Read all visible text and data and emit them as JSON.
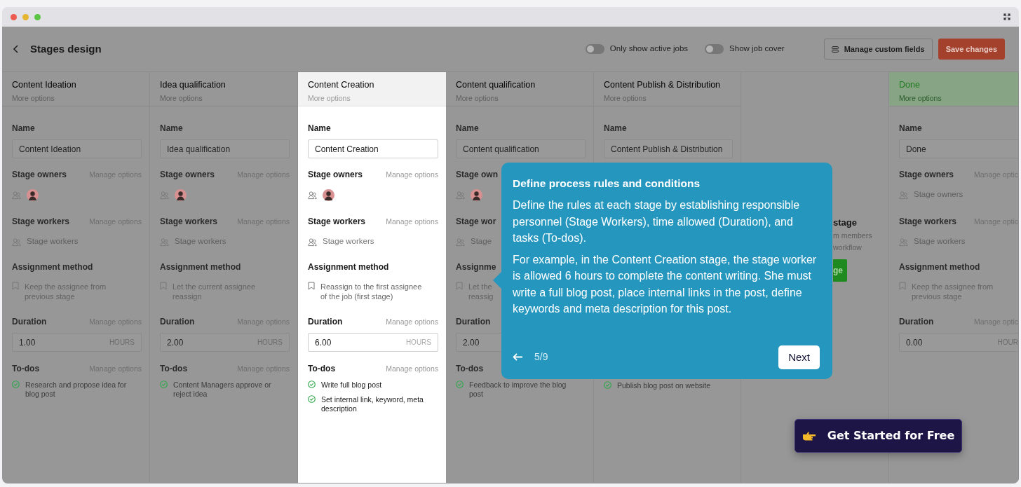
{
  "header": {
    "title": "Stages design",
    "toggles": [
      {
        "label": "Only show active jobs",
        "on": false
      },
      {
        "label": "Show job cover",
        "on": false
      }
    ],
    "buttons": [
      {
        "label": "Manage custom fields",
        "kind": "outline"
      },
      {
        "label": "Save changes",
        "kind": "primary"
      }
    ]
  },
  "stages": [
    {
      "kind": "stage",
      "name": "Content Ideation",
      "more": "More options",
      "selected": false,
      "sections": [
        {
          "kind": "name",
          "label": "Name",
          "value": "Content Ideation"
        },
        {
          "kind": "people",
          "label": "Stage owners",
          "manage": "Manage options",
          "avatar": true
        },
        {
          "kind": "people",
          "label": "Stage workers",
          "manage": "Manage options",
          "empty_text": "Stage workers"
        },
        {
          "kind": "assign",
          "label": "Assignment method",
          "lines": [
            "Keep the assignee from",
            "previous stage"
          ]
        },
        {
          "kind": "duration",
          "label": "Duration",
          "manage": "Manage options",
          "value": "1.00",
          "unit": "HOURS"
        },
        {
          "kind": "todos",
          "label": "To-dos",
          "manage": "Manage options",
          "items": [
            "Research and propose idea for blog post"
          ]
        }
      ]
    },
    {
      "kind": "stage",
      "name": "Idea qualification",
      "more": "More options",
      "selected": false,
      "sections": [
        {
          "kind": "name",
          "label": "Name",
          "value": "Idea qualification"
        },
        {
          "kind": "people",
          "label": "Stage owners",
          "manage": "Manage options",
          "avatar": true
        },
        {
          "kind": "people",
          "label": "Stage workers",
          "manage": "Manage options",
          "empty_text": "Stage workers"
        },
        {
          "kind": "assign",
          "label": "Assignment method",
          "lines": [
            "Let the current assignee",
            "reassign"
          ]
        },
        {
          "kind": "duration",
          "label": "Duration",
          "manage": "Manage options",
          "value": "2.00",
          "unit": "HOURS"
        },
        {
          "kind": "todos",
          "label": "To-dos",
          "manage": "Manage options",
          "items": [
            "Content Managers approve or reject idea"
          ]
        }
      ]
    },
    {
      "kind": "stage",
      "name": "Content Creation",
      "more": "More options",
      "selected": true,
      "sections": [
        {
          "kind": "name",
          "label": "Name",
          "value": "Content Creation"
        },
        {
          "kind": "people",
          "label": "Stage owners",
          "manage": "Manage options",
          "avatar": true
        },
        {
          "kind": "people",
          "label": "Stage workers",
          "manage": "Manage options",
          "empty_text": "Stage workers"
        },
        {
          "kind": "assign",
          "label": "Assignment method",
          "lines": [
            "Reassign to the first assignee",
            "of the job (first stage)"
          ]
        },
        {
          "kind": "duration",
          "label": "Duration",
          "manage": "Manage options",
          "value": "6.00",
          "unit": "HOURS"
        },
        {
          "kind": "todos",
          "label": "To-dos",
          "manage": "Manage options",
          "items": [
            "Write full blog post",
            "Set internal link, keyword, meta description"
          ]
        }
      ]
    },
    {
      "kind": "stage",
      "name": "Content qualification",
      "more": "More options",
      "selected": false,
      "sections": [
        {
          "kind": "name",
          "label": "Name",
          "value": "Content qualification"
        },
        {
          "kind": "people",
          "label": "Stage own",
          "avatar": true
        },
        {
          "kind": "people",
          "label": "Stage wor",
          "empty_text": "Stage"
        },
        {
          "kind": "assign",
          "label": "Assignme",
          "lines": [
            "Let the",
            "reassig"
          ]
        },
        {
          "kind": "duration",
          "label": "Duration",
          "value": "2.00"
        },
        {
          "kind": "todos",
          "label": "To-dos",
          "items": [
            "Feedback to improve the blog post"
          ]
        }
      ]
    },
    {
      "kind": "stage",
      "name": "Content Publish & Distribution",
      "more": "More options",
      "selected": false,
      "sections": [
        {
          "kind": "name",
          "label": "Name",
          "value": "Content Publish & Distribution"
        },
        {
          "kind": "blank"
        },
        {
          "kind": "blank"
        },
        {
          "kind": "blank"
        },
        {
          "kind": "blank"
        },
        {
          "kind": "todos",
          "items": [
            "Publish blog post on website"
          ]
        }
      ]
    },
    {
      "kind": "add",
      "title": "stage",
      "lines": [
        "m members",
        "workflow"
      ],
      "button": "ge"
    },
    {
      "kind": "done",
      "name": "Done",
      "more": "More options",
      "selected": false,
      "sections": [
        {
          "kind": "name",
          "label": "Name",
          "value": "Done"
        },
        {
          "kind": "people",
          "label": "Stage owners",
          "manage": "Manage optic",
          "empty_text": "Stage owners"
        },
        {
          "kind": "people",
          "label": "Stage workers",
          "manage": "Manage optic",
          "empty_text": "Stage workers"
        },
        {
          "kind": "assign",
          "label": "Assignment method",
          "lines": [
            "Keep the assignee from",
            "previous stage"
          ]
        },
        {
          "kind": "duration",
          "label": "Duration",
          "manage": "Manage optic",
          "value": "0.00",
          "unit": "HOUR"
        }
      ]
    }
  ],
  "tour": {
    "title": "Define process rules and conditions",
    "paragraphs": [
      "Define the rules at each stage by establishing responsible personnel (Stage Workers), time allowed (Duration), and tasks (To-dos).",
      "For example, in the Content Creation stage, the stage worker is allowed 6 hours to complete the content writing. She must write a full blog post, place internal links in the post, define keywords and meta description for this post."
    ],
    "step": "5/9",
    "next": "Next"
  },
  "cta": {
    "label": "Get Started for Free"
  }
}
